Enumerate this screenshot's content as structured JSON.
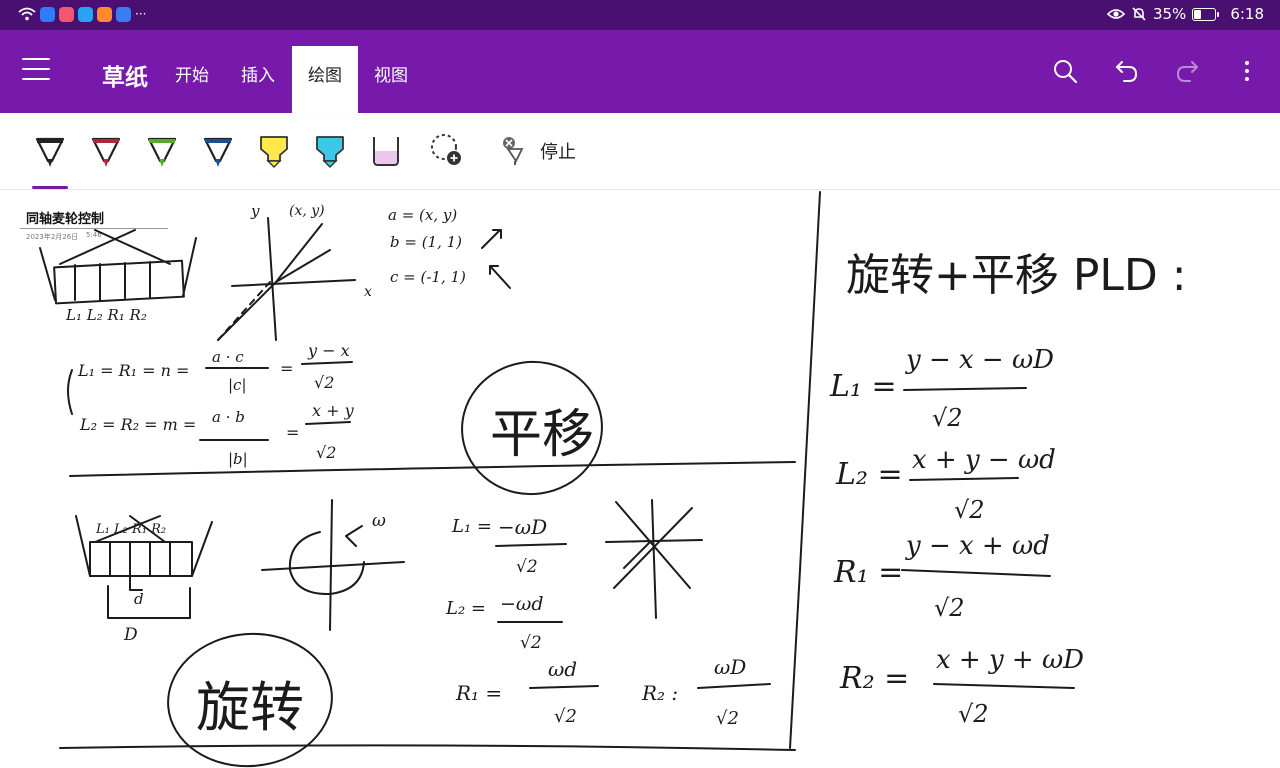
{
  "status_bar": {
    "signal_text": "⁶",
    "more_indicator": "···",
    "battery_percent": "35%",
    "battery_level": 0.35,
    "time": "6:18",
    "icons": [
      "wifi-icon",
      "security-app-icon",
      "notes-app-icon",
      "search-app-icon",
      "video-app-icon",
      "mail-app-icon",
      "eye-icon",
      "mute-bell-icon",
      "battery-icon"
    ]
  },
  "app_bar": {
    "title": "草纸",
    "tabs": [
      {
        "label": "开始",
        "active": false
      },
      {
        "label": "插入",
        "active": false
      },
      {
        "label": "绘图",
        "active": true
      },
      {
        "label": "视图",
        "active": false
      }
    ],
    "actions": [
      "search-icon",
      "undo-icon",
      "redo-icon",
      "more-vert-icon"
    ],
    "bar_color": "#7719aa",
    "status_color": "#4a1071"
  },
  "ribbon": {
    "pens": [
      {
        "name": "pen-black",
        "color": "#222222"
      },
      {
        "name": "pen-red",
        "color": "#b0263a"
      },
      {
        "name": "pen-green",
        "color": "#5ba82c"
      },
      {
        "name": "pen-blue",
        "color": "#1f4e8c"
      },
      {
        "name": "highlighter-yellow",
        "color": "#ffe84a"
      },
      {
        "name": "highlighter-cyan",
        "color": "#3cc8e8"
      },
      {
        "name": "highlighter-pink",
        "color": "#ecc7ec"
      }
    ],
    "add_pen_icon": "lasso-add-icon",
    "stop_label": "停止"
  },
  "page": {
    "heading": "同轴麦轮控制",
    "date": "2023年2月26日",
    "time": "5:46"
  },
  "notes": {
    "axes_y": "y",
    "point": "(x, y)",
    "axes_x": "x",
    "vec_a": "a = (x, y)",
    "vec_b": "b = (1, 1)",
    "vec_c": "c = (-1, 1)",
    "wheel_labels": "L₁  L₂  R₁  R₂",
    "eq1_left": "L₁ = R₁ = n =",
    "eq1_frac_top": "a · c",
    "eq1_frac_bot": "|c|",
    "eq1_result_top": "y − x",
    "eq1_result_bot": "√2",
    "eq2_left": "L₂ = R₂ = m =",
    "eq2_frac_top": "a · b",
    "eq2_frac_bot": "|b|",
    "eq2_result_top": "x + y",
    "eq2_result_bot": "√2",
    "circled_translation": "平移",
    "circled_rotation": "旋转",
    "omega": "ω",
    "d_label": "d",
    "D_label": "D",
    "rot_L1_top": "−ωD",
    "rot_L2_top": "−ωd",
    "rot_R1_top": "ωd",
    "rot_R2_top": "ωD",
    "sqrt2": "√2",
    "rot_L1_name": "L₁ =",
    "rot_L2_name": "L₂ =",
    "rot_R1_name": "R₁ =",
    "rot_R2_name": "R₂ :",
    "combined_title": "旋转+平移 PLD :",
    "comb_L1_name": "L₁ =",
    "comb_L1_top": "y − x − ωD",
    "comb_L2_name": "L₂ =",
    "comb_L2_top": "x + y − ωd",
    "comb_R1_name": "R₁ =",
    "comb_R1_top": "y − x + ωd",
    "comb_R2_name": "R₂ =",
    "comb_R2_top": "x + y + ωD"
  }
}
